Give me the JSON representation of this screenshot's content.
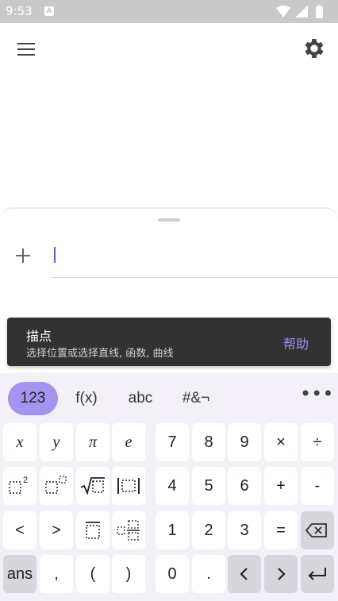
{
  "status_bar": {
    "time": "9:53",
    "notification_icon": "A"
  },
  "app_bar": {
    "menu_icon": "menu-icon",
    "settings_icon": "gear-icon"
  },
  "snackbar": {
    "title": "描点",
    "subtitle": "选择位置或选择直线, 函数, 曲线",
    "action": "帮助"
  },
  "keyboard": {
    "tabs": [
      "123",
      "f(x)",
      "abc",
      "#&¬"
    ],
    "active_tab": "123",
    "more_label": "•••",
    "keys": {
      "x": "x",
      "y": "y",
      "pi": "π",
      "e": "e",
      "seven": "7",
      "eight": "8",
      "nine": "9",
      "times": "×",
      "divide": "÷",
      "four": "4",
      "five": "5",
      "six": "6",
      "plus": "+",
      "minus": "-",
      "less": "<",
      "greater": ">",
      "one": "1",
      "two": "2",
      "three": "3",
      "equals": "=",
      "ans": "ans",
      "comma": ",",
      "lparen": "(",
      "rparen": ")",
      "zero": "0",
      "dot": "."
    }
  },
  "colors": {
    "accent": "#a593f0",
    "snackbar_bg": "#323232",
    "snackbar_action": "#9f8cf0",
    "keyboard_bg": "#f3f1f7",
    "cursor": "#6557d2"
  }
}
